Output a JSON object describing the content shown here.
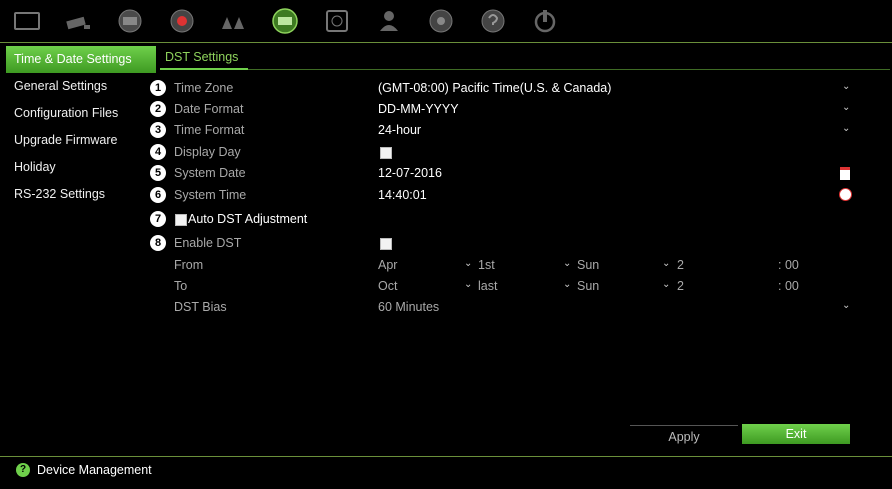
{
  "top_nav": [
    {
      "icon": "monitor-icon"
    },
    {
      "icon": "camera-icon"
    },
    {
      "icon": "network-icon"
    },
    {
      "icon": "record-icon"
    },
    {
      "icon": "alarm-icon"
    },
    {
      "icon": "device-icon"
    },
    {
      "icon": "hdd-icon"
    },
    {
      "icon": "user-icon"
    },
    {
      "icon": "system-icon"
    },
    {
      "icon": "help-icon"
    },
    {
      "icon": "shutdown-icon"
    }
  ],
  "sidebar": {
    "items": [
      {
        "label": "Time & Date Settings"
      },
      {
        "label": "General Settings"
      },
      {
        "label": "Configuration Files"
      },
      {
        "label": "Upgrade Firmware"
      },
      {
        "label": "Holiday"
      },
      {
        "label": "RS-232 Settings"
      }
    ]
  },
  "tab": {
    "label": "DST Settings"
  },
  "fields": {
    "time_zone": {
      "num": "1",
      "label": "Time Zone",
      "value": "(GMT-08:00) Pacific Time(U.S. & Canada)"
    },
    "date_format": {
      "num": "2",
      "label": "Date Format",
      "value": "DD-MM-YYYY"
    },
    "time_format": {
      "num": "3",
      "label": "Time Format",
      "value": "24-hour"
    },
    "display_day": {
      "num": "4",
      "label": "Display Day"
    },
    "system_date": {
      "num": "5",
      "label": "System Date",
      "value": "12-07-2016"
    },
    "system_time": {
      "num": "6",
      "label": "System Time",
      "value": "14:40:01"
    },
    "auto_dst": {
      "num": "7",
      "label": "Auto DST Adjustment"
    },
    "enable_dst": {
      "num": "8",
      "label": "Enable DST"
    },
    "from": {
      "label": "From",
      "month": "Apr",
      "week": "1st",
      "day": "Sun",
      "hour": "2",
      "minute": ": 00"
    },
    "to": {
      "label": "To",
      "month": "Oct",
      "week": "last",
      "day": "Sun",
      "hour": "2",
      "minute": ": 00"
    },
    "dst_bias": {
      "label": "DST Bias",
      "value": "60 Minutes"
    }
  },
  "buttons": {
    "apply": "Apply",
    "exit": "Exit"
  },
  "footer": {
    "label": "Device Management"
  },
  "colors": {
    "accent": "#6fd04b",
    "accent_dark": "#3e9a22",
    "alert": "#d33333"
  }
}
